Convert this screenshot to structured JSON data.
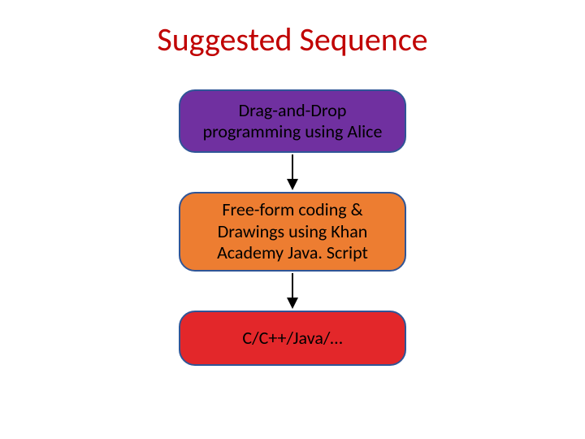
{
  "title": "Suggested Sequence",
  "steps": {
    "s1": "Drag-and-Drop programming using Alice",
    "s2": "Free-form coding & Drawings using Khan Academy Java. Script",
    "s3": "C/C++/Java/…"
  },
  "colors": {
    "title": "#c00000",
    "box_border": "#2f5597",
    "step1_bg": "#7030a0",
    "step2_bg": "#ed7d31",
    "step3_bg": "#e3272a",
    "arrow": "#000000"
  }
}
